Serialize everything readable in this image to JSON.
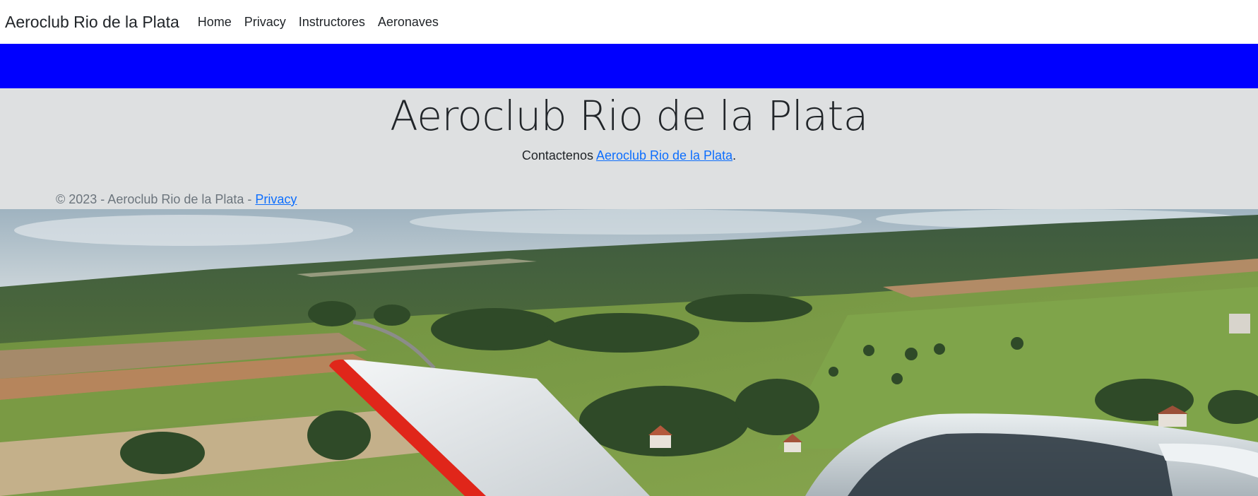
{
  "navbar": {
    "brand": "Aeroclub Rio de la Plata",
    "links": [
      {
        "label": "Home"
      },
      {
        "label": "Privacy"
      },
      {
        "label": "Instructores"
      },
      {
        "label": "Aeronaves"
      }
    ]
  },
  "banner": {
    "color": "#0000ff"
  },
  "hero": {
    "title": "Aeroclub Rio de la Plata",
    "contact_prefix": "Contactenos ",
    "contact_link": "Aeroclub Rio de la Plata",
    "contact_suffix": "."
  },
  "footer": {
    "text": "© 2023 - Aeroclub Rio de la Plata - ",
    "privacy_link": "Privacy"
  },
  "colors": {
    "link": "#0d6efd",
    "hero_bg": "#dee0e1",
    "text": "#212529",
    "muted": "#6c757d"
  }
}
